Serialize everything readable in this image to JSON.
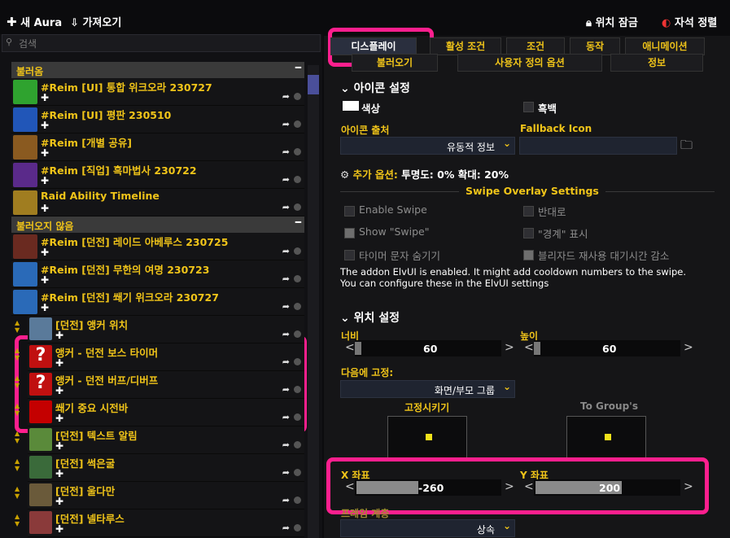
{
  "topbar": {
    "new_label": "새 Aura",
    "import_label": "가져오기",
    "lock_label": "위치 잠금",
    "magnet_label": "자석 정렬"
  },
  "search": {
    "placeholder": "검색"
  },
  "groups": {
    "loaded": "불러옴",
    "unloaded": "불러오지 않음"
  },
  "loaded_items": [
    {
      "title": "#Reim [UI] 통합 위크오라 230727",
      "icon": "crosshair-icon",
      "color": "#2fa32f"
    },
    {
      "title": "#Reim [UI] 평판 230510",
      "icon": "banner-icon",
      "color": "#2156b8"
    },
    {
      "title": "#Reim [개별 공유]",
      "icon": "wow-logo-icon",
      "color": "#8a5a20"
    },
    {
      "title": "#Reim [직업] 흑마법사 230722",
      "icon": "warlock-icon",
      "color": "#5a2a8a"
    },
    {
      "title": "Raid Ability Timeline",
      "icon": "clock-icon",
      "color": "#a07d20"
    }
  ],
  "unloaded_items": [
    {
      "title": "#Reim [던전] 레이드 아베루스 230725",
      "icon": "fire-pillar-icon",
      "color": "#6a2a20"
    },
    {
      "title": "#Reim [던전] 무한의 여명 230723",
      "icon": "swirl-icon",
      "color": "#2a6ab8"
    },
    {
      "title": "#Reim [던전] 쐐기 위크오라 230727",
      "icon": "swirl-icon",
      "color": "#2a6ab8"
    }
  ],
  "children": [
    {
      "title": "[던전] 앵커 위치",
      "icon": "map-icon",
      "color": "#5a7a9a"
    },
    {
      "title": "앵커 - 던전 보스 타이머",
      "icon": "question-icon",
      "color": "#c01010"
    },
    {
      "title": "앵커 - 던전 버프/디버프",
      "icon": "question-icon",
      "color": "#c01010"
    },
    {
      "title": "쐐기 중요 시전바",
      "icon": "red-bar-icon",
      "color": "#c40000"
    },
    {
      "title": "[던전] 텍스트 알림",
      "icon": "face-icon",
      "color": "#5a8a3a"
    },
    {
      "title": "[던전] 썩은굴",
      "icon": "creature-icon",
      "color": "#3a6a3a"
    },
    {
      "title": "[던전] 울다만",
      "icon": "spider-icon",
      "color": "#6a5a3a"
    },
    {
      "title": "[던전] 넬타루스",
      "icon": "dragon-icon",
      "color": "#8a3a3a"
    }
  ],
  "tabs_row1": [
    "디스플레이",
    "활성 조건",
    "조건",
    "동작",
    "애니메이션"
  ],
  "tabs_row2": [
    "불러오기",
    "사용자 정의 옵션",
    "정보"
  ],
  "icon_settings": {
    "header": "아이콘 설정",
    "color_label": "색상",
    "desaturate_label": "흑백",
    "source_label": "아이콘 출처",
    "source_value": "유동적 정보",
    "fallback_label": "Fallback Icon",
    "extra_options": "추가 옵션:",
    "extra_values": "투명도: 0% 확대: 20%"
  },
  "swipe": {
    "header": "Swipe Overlay Settings",
    "enable_swipe": "Enable Swipe",
    "reverse": "반대로",
    "show_swipe": "Show \"Swipe\"",
    "show_edge": "\"경계\" 표시",
    "hide_timer": "타이머 문자 숨기기",
    "blizzard_cd": "블리자드 재사용 대기시간 감소",
    "note": "The addon ElvUI is enabled. It might add cooldown numbers to the swipe. You can configure these in the ElvUI settings"
  },
  "position": {
    "header": "위치 설정",
    "width_label": "너비",
    "width_value": "60",
    "height_label": "높이",
    "height_value": "60",
    "anchor_label": "다음에 고정:",
    "anchor_value": "화면/부모 그룹",
    "anchor_point_label": "고정시키기",
    "to_group_label": "To Group's",
    "x_label": "X 좌표",
    "x_value": "-260",
    "y_label": "Y 좌표",
    "y_value": "200",
    "frame_label": "프레임 계층",
    "frame_value": "상속"
  },
  "colors": {
    "accent": "#f0c419",
    "highlight": "#ff1f8e",
    "group_bg": "#3a3a3a"
  }
}
